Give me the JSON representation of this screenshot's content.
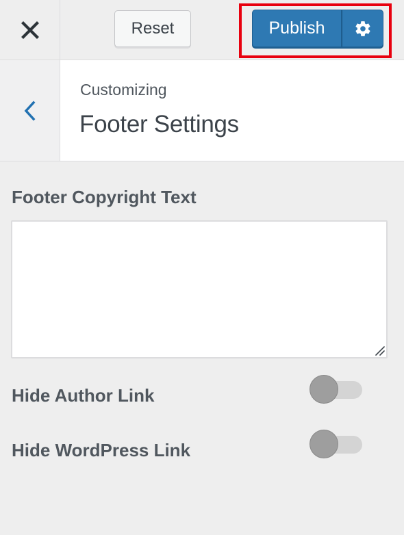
{
  "header": {
    "close_label": "Close",
    "reset_label": "Reset",
    "publish_label": "Publish",
    "settings_label": "Publish Settings"
  },
  "section": {
    "back_label": "Back",
    "customizing_label": "Customizing",
    "title": "Footer Settings"
  },
  "controls": {
    "copyright": {
      "label": "Footer Copyright Text",
      "value": ""
    },
    "hide_author": {
      "label": "Hide Author Link",
      "enabled": false
    },
    "hide_wordpress": {
      "label": "Hide WordPress Link",
      "enabled": false
    }
  },
  "colors": {
    "primary": "#2e79b3",
    "highlight": "#e8000e",
    "background": "#eeeeee"
  },
  "icons": {
    "close": "close-icon",
    "gear": "gear-icon",
    "back": "chevron-left-icon"
  }
}
